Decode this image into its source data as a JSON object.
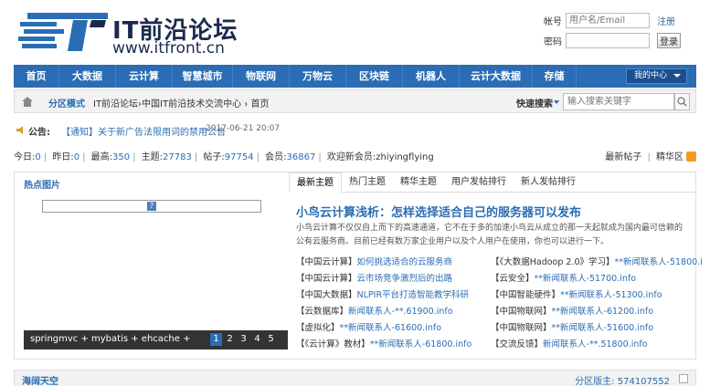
{
  "logo": {
    "title": "IT前沿论坛",
    "url": "www.itfront.cn"
  },
  "login": {
    "user_label": "帐号",
    "user_placeholder": "用户名/Email",
    "register_link": "注册",
    "pass_label": "密码",
    "login_button": "登录"
  },
  "nav": {
    "items": [
      "首页",
      "大数据",
      "云计算",
      "智慧城市",
      "物联网",
      "万物云",
      "区块链",
      "机器人",
      "云计大数据",
      "存储"
    ],
    "my_center": "我的中心"
  },
  "breadcrumb": {
    "mode": "分区模式",
    "path": "IT前沿论坛›中国IT前沿技术交流中心 › 首页",
    "search_label": "快速搜索",
    "search_placeholder": "输入搜索关键字"
  },
  "notice": {
    "label": "公告:",
    "text": "【通知】关于新广告法限用词的禁用公告",
    "date": "2017-06-21 20:07"
  },
  "stats": {
    "today_label": "今日:",
    "today": "0",
    "yesterday_label": "昨日:",
    "yesterday": "0",
    "max_label": "最高:",
    "max": "350",
    "topics_label": "主题:",
    "topics": "27783",
    "posts_label": "帖子:",
    "posts": "97754",
    "members_label": "会员:",
    "members": "36867",
    "newest_label": "欢迎新会员:",
    "newest": "zhiyingflying",
    "new_posts": "最新帖子",
    "digest": "精华区"
  },
  "feature": {
    "left_title": "热点图片",
    "caption": "springmvc + mybatis + ehcache +",
    "pages": [
      "1",
      "2",
      "3",
      "4",
      "5"
    ],
    "tabs": [
      "最新主题",
      "热门主题",
      "精华主题",
      "用户发帖排行",
      "新人发帖排行"
    ],
    "headline": "小鸟云计算浅析：怎样选择适合自己的服务器可以发布",
    "summary": "小鸟云计算不仅仅自上而下的高速通道，它不在于多的加速小鸟云从成立的那一天起就成为国内最可信赖的公有云服务商。目前已经有数万家企业用户以及个人用户在使用，你也可以进行一下。",
    "links": [
      {
        "cat": "【中国云计算】",
        "text": "如何挑选适合的云服务商"
      },
      {
        "cat": "【《大数据Hadoop 2.0》学习】",
        "text": "**新闻联系人-51800.i"
      },
      {
        "cat": "【中国云计算】",
        "text": "云市场竞争激烈后的出路"
      },
      {
        "cat": "【云安全】",
        "text": "**新闻联系人-51700.info"
      },
      {
        "cat": "【中国大数据】",
        "text": "NLPIR平台打造智能教学科研"
      },
      {
        "cat": "【中国智能硬件】",
        "text": "**新闻联系人-51300.info"
      },
      {
        "cat": "【云数据库】",
        "text": "新闻联系人-**.61900.info"
      },
      {
        "cat": "【中国物联网】",
        "text": "**新闻联系人-61200.info"
      },
      {
        "cat": "【虚拟化】",
        "text": "**新闻联系人-61600.info"
      },
      {
        "cat": "【中国物联网】",
        "text": "**新闻联系人-51600.info"
      },
      {
        "cat": "【《云计算》教材】",
        "text": "**新闻联系人-61800.info"
      },
      {
        "cat": "【交流反馈】",
        "text": "新闻联系人-**.51800.info"
      }
    ]
  },
  "section": {
    "title": "海阔天空",
    "moderator": "分区版主: 574107552"
  },
  "colors": {
    "nav": "#2b6db4",
    "link": "#2b6db4"
  }
}
